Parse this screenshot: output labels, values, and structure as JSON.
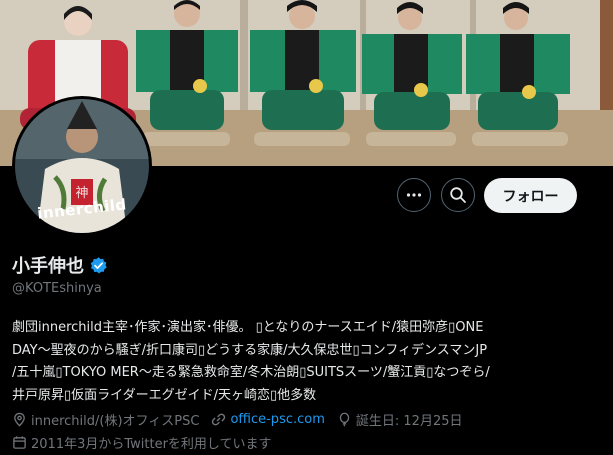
{
  "header": {
    "more_button_icon": "more-horizontal-icon",
    "search_button_icon": "search-icon",
    "follow_label": "フォロー"
  },
  "avatar": {
    "text": "innerchild"
  },
  "profile": {
    "name": "小手伸也",
    "handle": "@KOTEshinya",
    "verified_color": "#1d9bf0",
    "bio_lines": [
      "劇団innerchild主宰･作家･演出家･俳優。 ▯となりのナースエイド/猿田弥彦▯ONE",
      "DAY～聖夜のから騒ぎ/折口康司▯どうする家康/大久保忠世▯コンフィデンスマンJP",
      "/五十嵐▯TOKYO MER～走る緊急救命室/冬木治朗▯SUITSスーツ/蟹江貢▯なつぞら/",
      "井戸原昇▯仮面ライダーエグゼイド/天ヶ崎恋▯他多数"
    ],
    "location": "innerchild/(株)オフィスPSC",
    "website": "office-psc.com",
    "birthday": "誕生日: 12月25日",
    "joined": "2011年3月からTwitterを利用しています"
  },
  "colors": {
    "background": "#000000",
    "text": "#e7e9ea",
    "secondary_text": "#71767b",
    "link": "#1d9bf0",
    "follow_bg": "#eff3f4"
  }
}
